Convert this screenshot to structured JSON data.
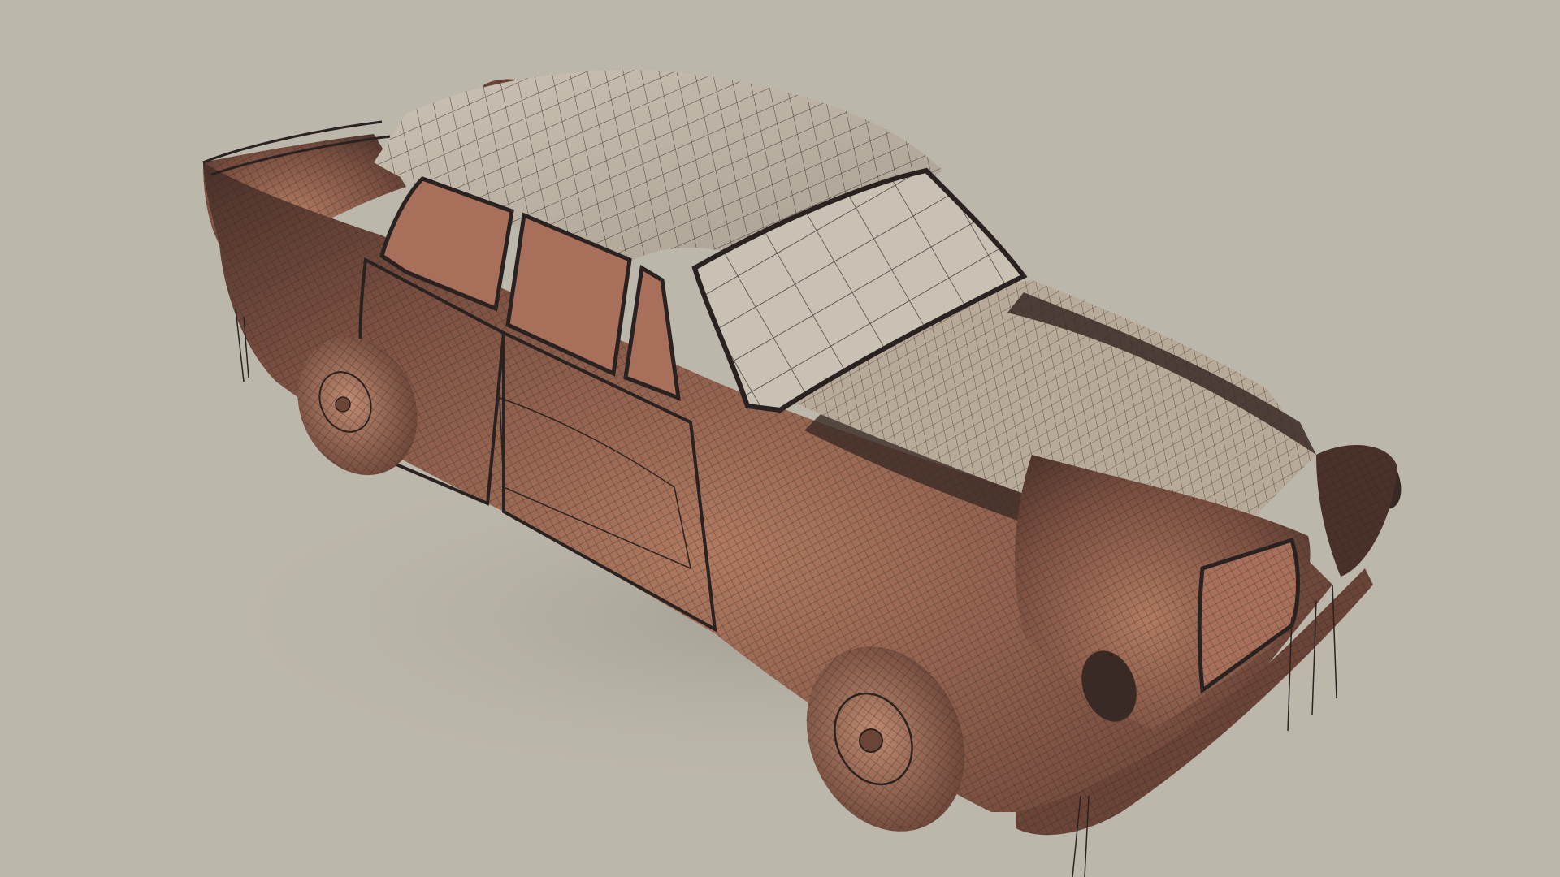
{
  "scene": {
    "subject": "car-wireframe",
    "colors": {
      "background": "#bcb7ab",
      "body": "#8c5a45",
      "body_light": "#b07a60",
      "body_dark": "#4a3129",
      "glass_top": "#c9c1b3",
      "glass_side": "#a8705a",
      "wire": "#2a2220",
      "shadow": "#9f9a8f"
    }
  }
}
